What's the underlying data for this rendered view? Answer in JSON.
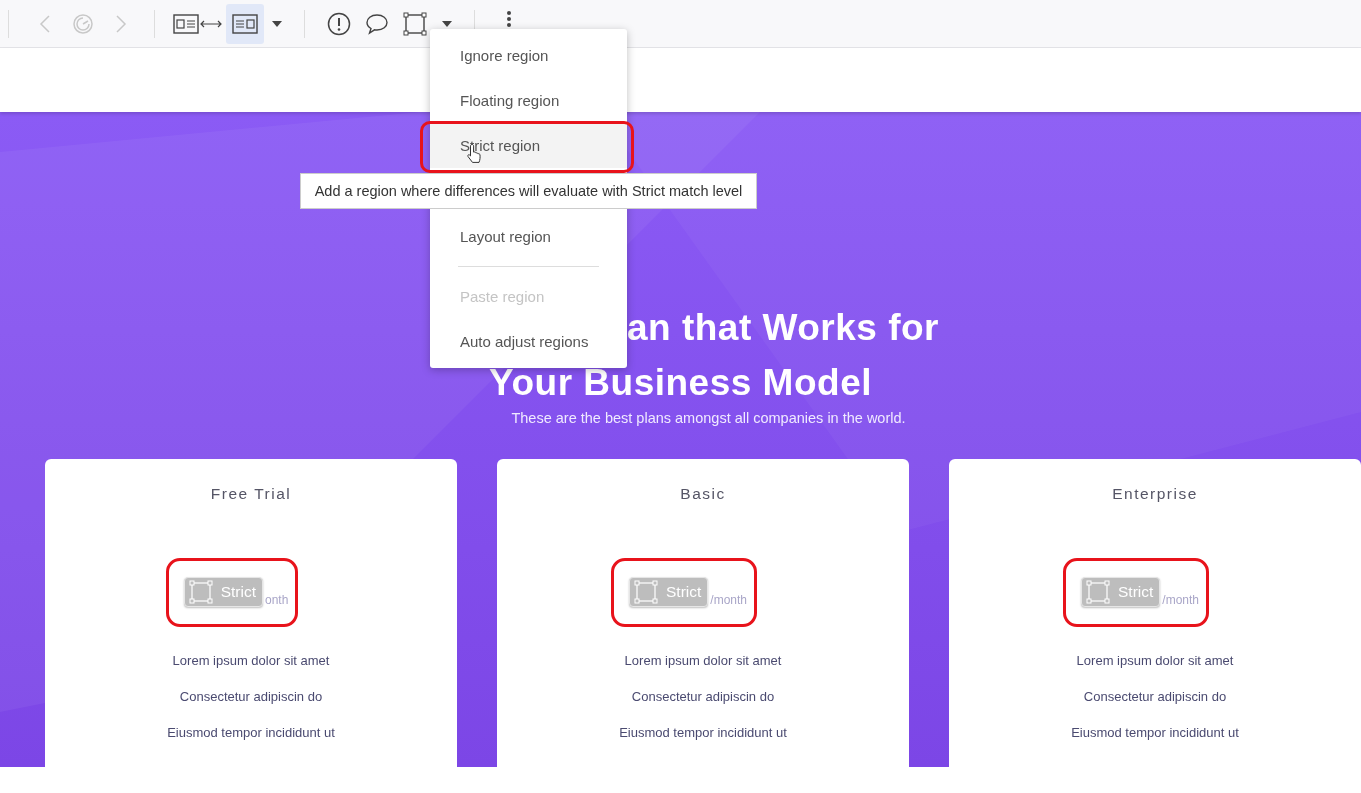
{
  "toolbar": {
    "groups": [
      [
        {
          "kind": "back",
          "disabled": true,
          "selected": false
        },
        {
          "kind": "refresh",
          "disabled": true,
          "selected": false
        },
        {
          "kind": "forward",
          "disabled": true,
          "selected": false
        }
      ],
      [
        {
          "kind": "compare",
          "disabled": false,
          "selected": false
        },
        {
          "kind": "layout",
          "disabled": false,
          "selected": true
        },
        {
          "kind": "dropdown",
          "disabled": false,
          "selected": false
        }
      ],
      [
        {
          "kind": "alert",
          "disabled": false,
          "selected": false
        },
        {
          "kind": "comment",
          "disabled": false,
          "selected": false
        },
        {
          "kind": "region",
          "disabled": false,
          "selected": false
        },
        {
          "kind": "dropdown",
          "disabled": false,
          "selected": false
        }
      ],
      [
        {
          "kind": "more",
          "disabled": false,
          "selected": false
        }
      ]
    ]
  },
  "region_menu": {
    "items": [
      {
        "kind": "item",
        "label": "Ignore region",
        "disabled": false,
        "highlighted": false
      },
      {
        "kind": "item",
        "label": "Floating region",
        "disabled": false,
        "highlighted": false
      },
      {
        "kind": "item",
        "label": "Strict region",
        "disabled": false,
        "highlighted": true
      },
      {
        "kind": "item",
        "label": "Layout region",
        "disabled": false,
        "highlighted": false
      },
      {
        "kind": "divider"
      },
      {
        "kind": "item",
        "label": "Paste region",
        "disabled": true,
        "highlighted": false
      },
      {
        "kind": "item",
        "label": "Auto adjust regions",
        "disabled": false,
        "highlighted": false
      }
    ]
  },
  "tooltip": "Add a region where differences will evaluate with Strict match level",
  "hero": {
    "headline": [
      "an that Works for",
      "Your Business Model"
    ],
    "subtitle": "These are the best plans amongst all companies in the world."
  },
  "plans": [
    {
      "name": "Free Trial",
      "badge": "Strict",
      "period": "onth",
      "features": [
        "Lorem ipsum dolor sit amet",
        "Consectetur adipiscin do",
        "Eiusmod tempor incididunt ut"
      ]
    },
    {
      "name": "Basic",
      "badge": "Strict",
      "period": "/month",
      "features": [
        "Lorem ipsum dolor sit amet",
        "Consectetur adipiscin do",
        "Eiusmod tempor incididunt ut"
      ]
    },
    {
      "name": "Enterprise",
      "badge": "Strict",
      "period": "/month",
      "features": [
        "Lorem ipsum dolor sit amet",
        "Consectetur adipiscin do",
        "Eiusmod tempor incididunt ut"
      ]
    }
  ]
}
